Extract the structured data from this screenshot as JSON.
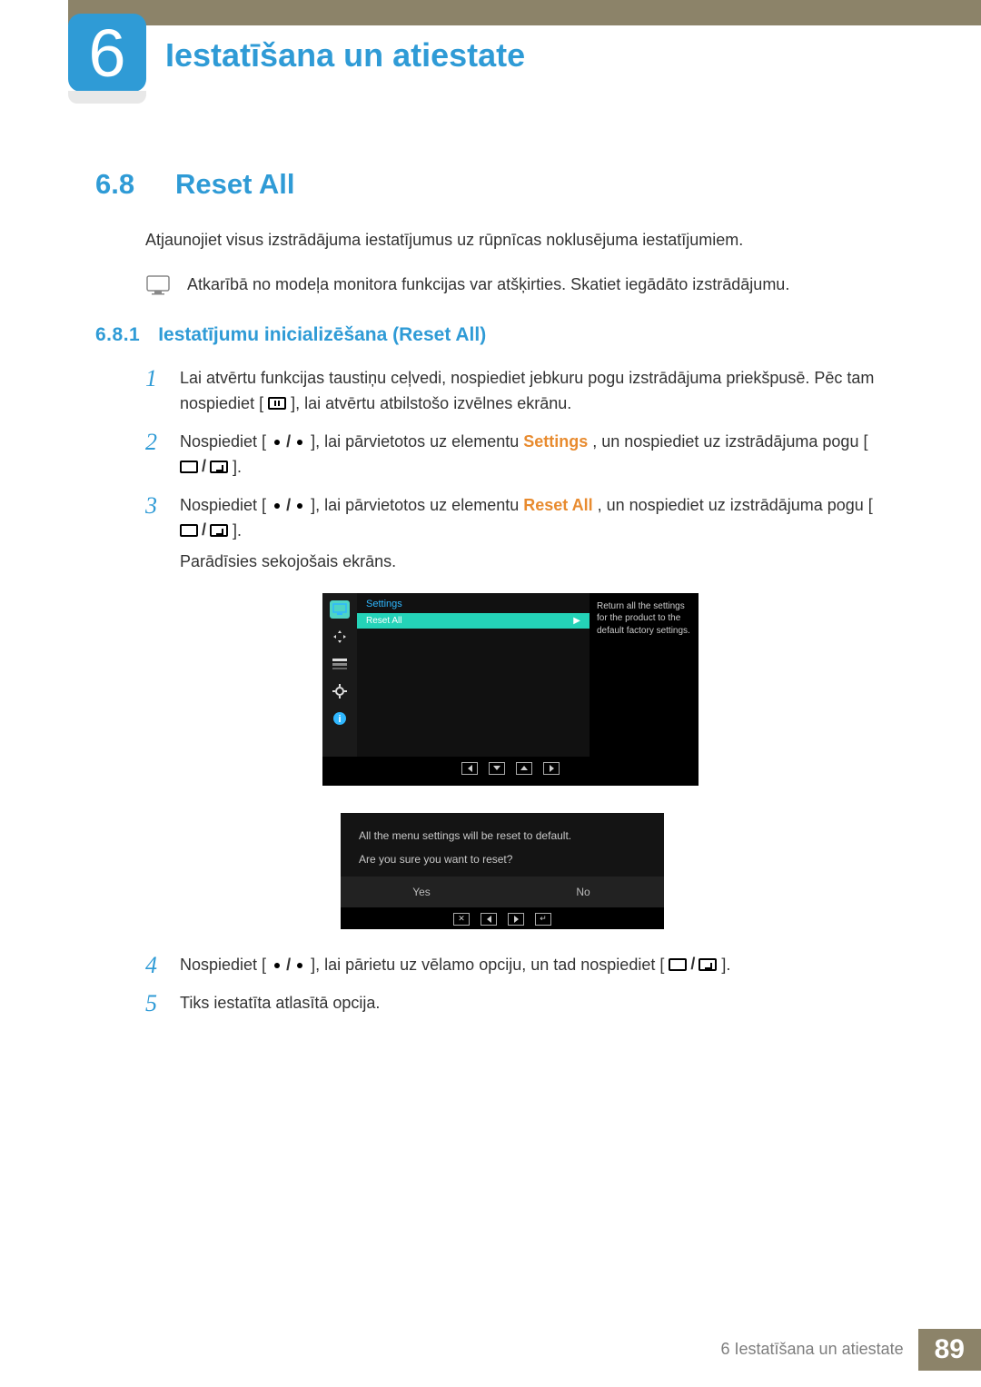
{
  "chapter": {
    "number": "6",
    "title": "Iestatīšana un atiestate"
  },
  "section": {
    "number": "6.8",
    "title": "Reset All",
    "intro": "Atjaunojiet visus izstrādājuma iestatījumus uz rūpnīcas noklusējuma iestatījumiem.",
    "note": "Atkarībā no modeļa monitora funkcijas var atšķirties. Skatiet iegādāto izstrādājumu."
  },
  "subsection": {
    "number": "6.8.1",
    "title": "Iestatījumu inicializēšana (Reset All)"
  },
  "steps": {
    "s1a": "Lai atvērtu funkcijas taustiņu ceļvedi, nospiediet jebkuru pogu izstrādājuma priekšpusē. Pēc tam nospiediet [",
    "s1b": "], lai atvērtu atbilstošo izvēlnes ekrānu.",
    "s2a": "Nospiediet [",
    "s2b": "], lai pārvietotos uz elementu ",
    "s2c": "Settings",
    "s2d": ", un nospiediet uz izstrādājuma pogu [",
    "s2e": "].",
    "s3a": "Nospiediet [",
    "s3b": "], lai pārvietotos uz elementu ",
    "s3c": "Reset All",
    "s3d": ", un nospiediet uz izstrādājuma pogu [",
    "s3e": "].",
    "s3follow": "Parādīsies sekojošais ekrāns.",
    "s4a": "Nospiediet [",
    "s4b": "], lai pārietu uz vēlamo opciju, un tad nospiediet [",
    "s4c": "].",
    "s5": "Tiks iestatīta atlasītā opcija."
  },
  "osd1": {
    "menu_title": "Settings",
    "row_label": "Reset All",
    "row_arrow": "▶",
    "desc": "Return all the settings for the product to the default factory settings."
  },
  "osd2": {
    "line1": "All the menu settings will be reset to default.",
    "line2": "Are you sure you want to reset?",
    "yes": "Yes",
    "no": "No"
  },
  "footer": {
    "text": "6 Iestatīšana un atiestate",
    "page": "89"
  }
}
